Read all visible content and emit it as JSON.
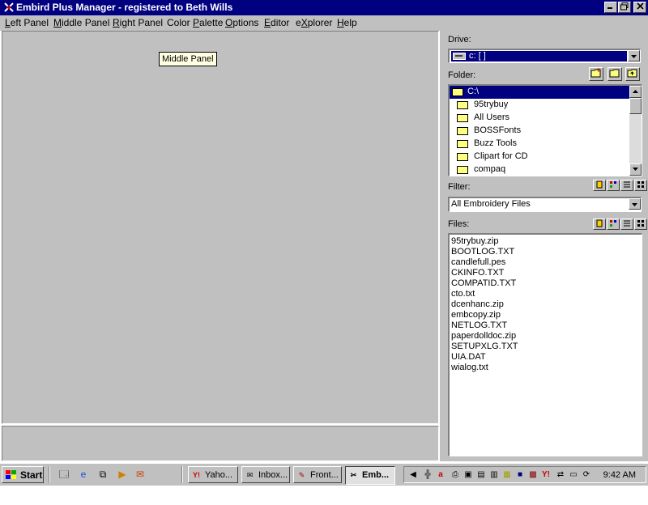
{
  "window": {
    "title": "Embird Plus Manager - registered to Beth Wills",
    "controls": [
      "minimize",
      "restore",
      "close"
    ]
  },
  "menu": [
    {
      "label": "Left Panel",
      "accel": "L"
    },
    {
      "label": "Middle Panel",
      "accel": "M"
    },
    {
      "label": "Right Panel",
      "accel": "R"
    },
    {
      "label": "Color Palette",
      "accel": "P"
    },
    {
      "label": "Options",
      "accel": "O"
    },
    {
      "label": "Editor",
      "accel": "E"
    },
    {
      "label": "eXplorer",
      "accel": "X"
    },
    {
      "label": "Help",
      "accel": "H"
    }
  ],
  "middle_panel": {
    "tooltip": "Middle Panel"
  },
  "right_panel": {
    "drive_label": "Drive:",
    "drive_value": "c: [ ]",
    "folder_label": "Folder:",
    "folders": [
      "C:\\",
      "95trybuy",
      "All Users",
      "BOSSFonts",
      "Buzz Tools",
      "Clipart for CD",
      "compaq"
    ],
    "selected_folder": "C:\\",
    "filter_label": "Filter:",
    "filter_value": "All Embroidery Files",
    "files_label": "Files:",
    "files": [
      "95trybuy.zip",
      "BOOTLOG.TXT",
      "candlefull.pes",
      "CKINFO.TXT",
      "COMPATID.TXT",
      "cto.txt",
      "dcenhanc.zip",
      "embcopy.zip",
      "NETLOG.TXT",
      "paperdolldoc.zip",
      "SETUPXLG.TXT",
      "UIA.DAT",
      "wialog.txt"
    ]
  },
  "taskbar": {
    "start_label": "Start",
    "tasks": [
      {
        "label": "Yaho...",
        "icon": "yahoo-icon"
      },
      {
        "label": "Inbox...",
        "icon": "inbox-icon"
      },
      {
        "label": "Front...",
        "icon": "frontpage-icon"
      },
      {
        "label": "Emb...",
        "icon": "embird-icon",
        "active": true
      }
    ],
    "clock": "9:42 AM"
  },
  "colors": {
    "titlebar": "#000080",
    "face": "#c0c0c0",
    "selection": "#000080",
    "tooltip_bg": "#ffffe1"
  }
}
